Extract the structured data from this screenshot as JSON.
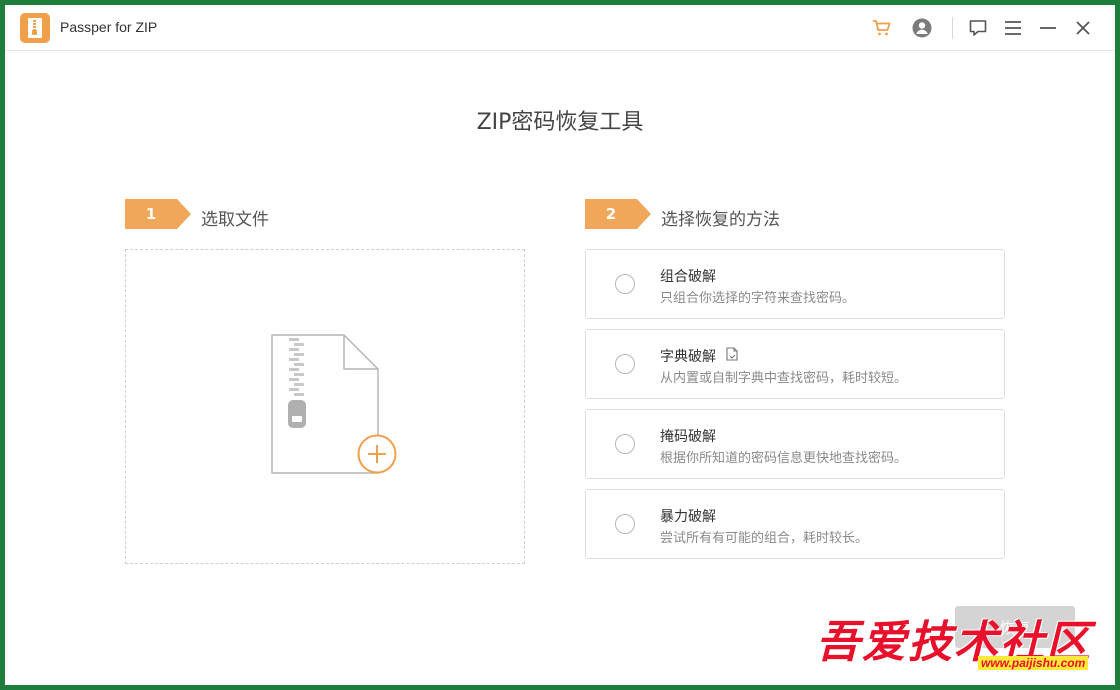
{
  "window": {
    "title": "Passper for ZIP"
  },
  "toolbar": {
    "icons": [
      "cart-icon",
      "account-icon",
      "feedback-icon",
      "menu-icon",
      "minimize-icon",
      "close-icon"
    ]
  },
  "main": {
    "title": "ZIP密码恢复工具"
  },
  "step1": {
    "number": "1",
    "label": "选取文件"
  },
  "step2": {
    "number": "2",
    "label": "选择恢复的方法"
  },
  "methods": [
    {
      "title": "组合破解",
      "desc": "只组合你选择的字符来查找密码。",
      "selected": false
    },
    {
      "title": "字典破解",
      "desc": "从内置或自制字典中查找密码，耗时较短。",
      "selected": false
    },
    {
      "title": "掩码破解",
      "desc": "根据你所知道的密码信息更快地查找密码。",
      "selected": false
    },
    {
      "title": "暴力破解",
      "desc": "尝试所有有可能的组合，耗时较长。",
      "selected": false
    }
  ],
  "footer": {
    "next_label": "恢复"
  },
  "watermark": {
    "text": "吾爱技术社区",
    "url": "www.paijishu.com"
  },
  "colors": {
    "accent": "#f0a75a",
    "window_border": "#1e7d3a",
    "watermark_red": "#e8102a"
  }
}
